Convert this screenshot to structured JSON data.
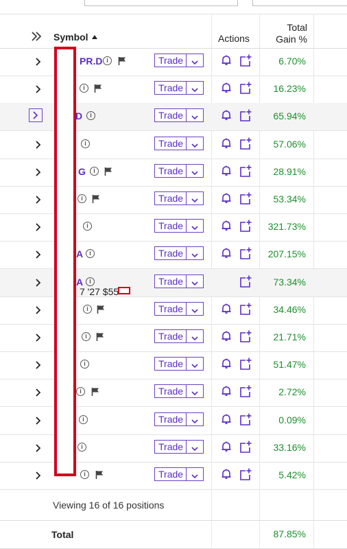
{
  "header": {
    "symbol_label": "Symbol",
    "actions_label": "Actions",
    "gain_line1": "Total",
    "gain_line2": "Gain %"
  },
  "rows": [
    {
      "symbol": "PR.D",
      "gain": "6.70%",
      "flag": true
    },
    {
      "symbol": "",
      "gain": "16.23%",
      "flag": true
    },
    {
      "symbol": "D",
      "gain": "65.94%",
      "flag": false
    },
    {
      "symbol": "",
      "gain": "57.06%",
      "flag": false
    },
    {
      "symbol": "G",
      "gain": "28.91%",
      "flag": true
    },
    {
      "symbol": "",
      "gain": "53.34%",
      "flag": true
    },
    {
      "symbol": "",
      "gain": "321.73%",
      "flag": false
    },
    {
      "symbol": "A",
      "gain": "207.15%",
      "flag": false
    },
    {
      "symbol": "A",
      "sub": "7 '27 $55",
      "gain": "73.34%",
      "flag": false
    },
    {
      "symbol": "",
      "gain": "34.46%",
      "flag": true
    },
    {
      "symbol": "",
      "gain": "21.71%",
      "flag": true
    },
    {
      "symbol": "",
      "gain": "51.47%",
      "flag": false
    },
    {
      "symbol": "",
      "gain": "2.72%",
      "flag": true
    },
    {
      "symbol": "",
      "gain": "0.09%",
      "flag": false
    },
    {
      "symbol": "",
      "gain": "33.16%",
      "flag": false
    },
    {
      "symbol": "",
      "gain": "5.42%",
      "flag": true
    }
  ],
  "trade_label": "Trade",
  "footer": {
    "viewing": "Viewing 16 of 16 positions"
  },
  "total": {
    "label": "Total",
    "gain": "87.85%"
  },
  "colors": {
    "accent": "#5a2dc4",
    "gain": "#1a8f2a",
    "redaction": "#d0001c"
  }
}
